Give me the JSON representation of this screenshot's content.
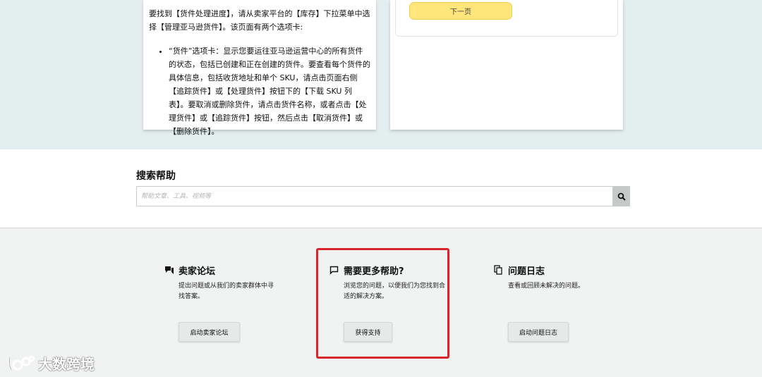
{
  "instructions": {
    "intro": "要找到【货件处理进度】，请从卖家平台的【库存】下拉菜单中选择【管理亚马逊货件】。该页面有两个选项卡:",
    "bullet": "“货件”选项卡：显示您要运往亚马逊运营中心的所有货件的状态，包括已创建和正在创建的货件。要查看每个货件的具体信息，包括收货地址和单个 SKU，请点击页面右侧【追踪货件】或【处理货件】按钮下的【下载 SKU 列表】。要取消或删除货件，请点击货件名称，或者点击【处理货件】或【追踪货件】按钮，然后点击【取消货件】或【删除货件】。"
  },
  "next_button": "下一页",
  "search": {
    "title": "搜索帮助",
    "placeholder": "帮助文章、工具、视频等",
    "icon": "search-icon"
  },
  "help_cards": [
    {
      "title": "卖家论坛",
      "desc": "提出问题或从我们的卖家群体中寻找答案。",
      "button": "启动卖家论坛",
      "icon": "forum-icon"
    },
    {
      "title": "需要更多帮助?",
      "desc": "浏览您的问题，以便我们为您找到合适的解决方案。",
      "button": "获得支持",
      "icon": "chat-bubble-icon"
    },
    {
      "title": "问题日志",
      "desc": "查看或回顾未解决的问题。",
      "button": "启动问题日志",
      "icon": "copy-log-icon"
    }
  ],
  "highlight_color": "#d8262a",
  "watermark": "大数跨境"
}
